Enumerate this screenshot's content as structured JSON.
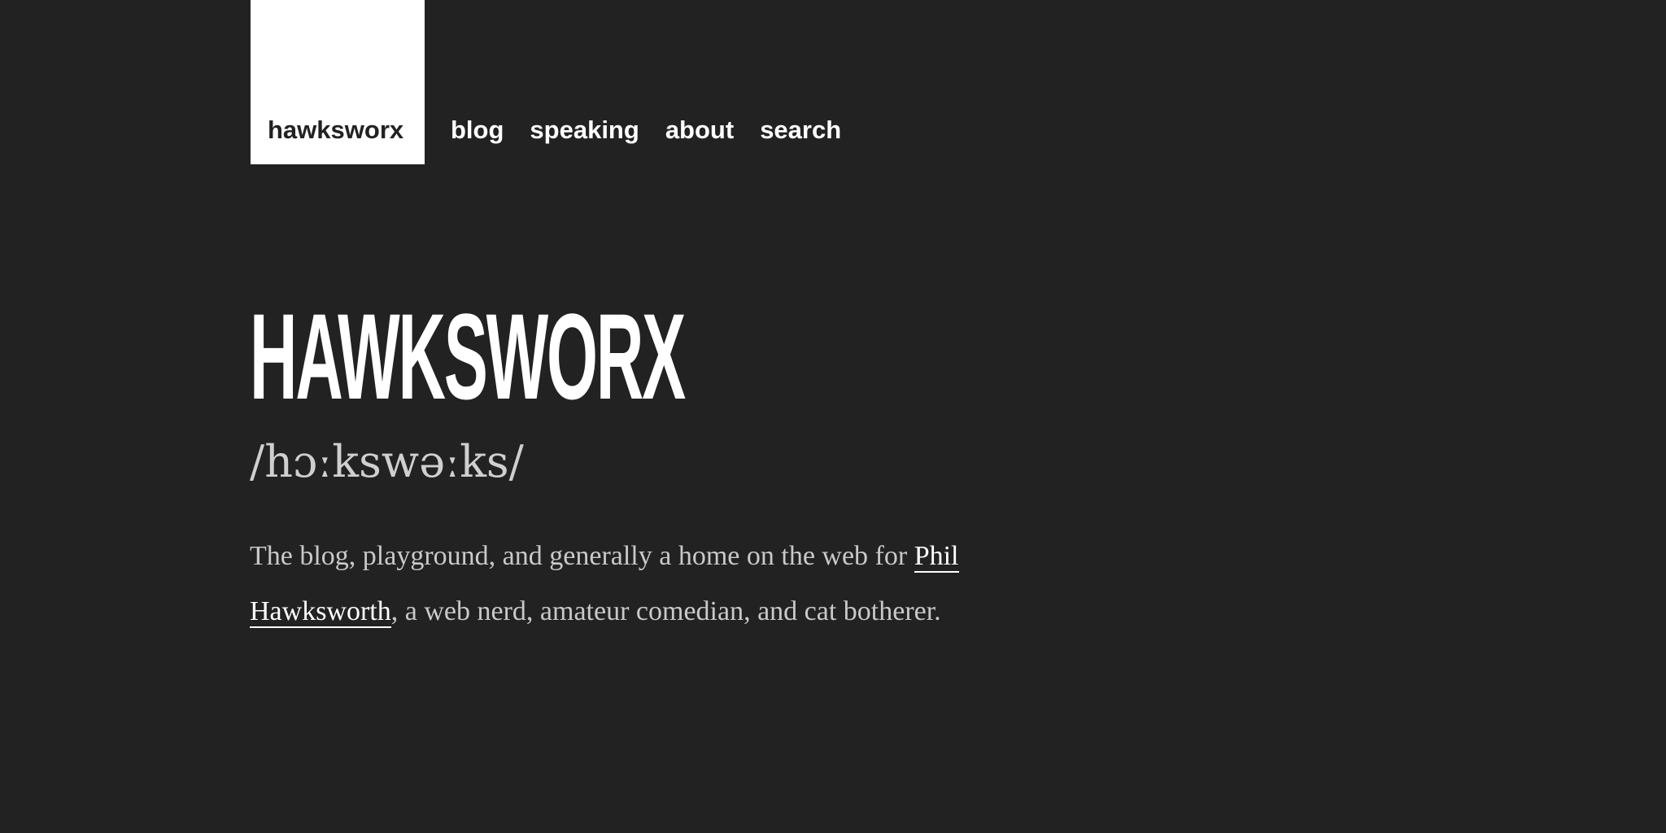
{
  "header": {
    "logo_text": "hawksworx",
    "nav": [
      {
        "label": "blog"
      },
      {
        "label": "speaking"
      },
      {
        "label": "about"
      },
      {
        "label": "search"
      }
    ]
  },
  "hero": {
    "title": "HAWKSWORX",
    "pronunciation": "/hɔːkswəːks/",
    "intro_before": "The blog, playground, and generally a home on the web for ",
    "intro_link": "Phil Hawksworth",
    "intro_after": ", a web nerd, amateur comedian, and cat botherer."
  },
  "colors": {
    "background": "#222222",
    "logo_background": "#ffffff",
    "text_primary": "#ffffff",
    "text_secondary": "#c9c9c9"
  }
}
